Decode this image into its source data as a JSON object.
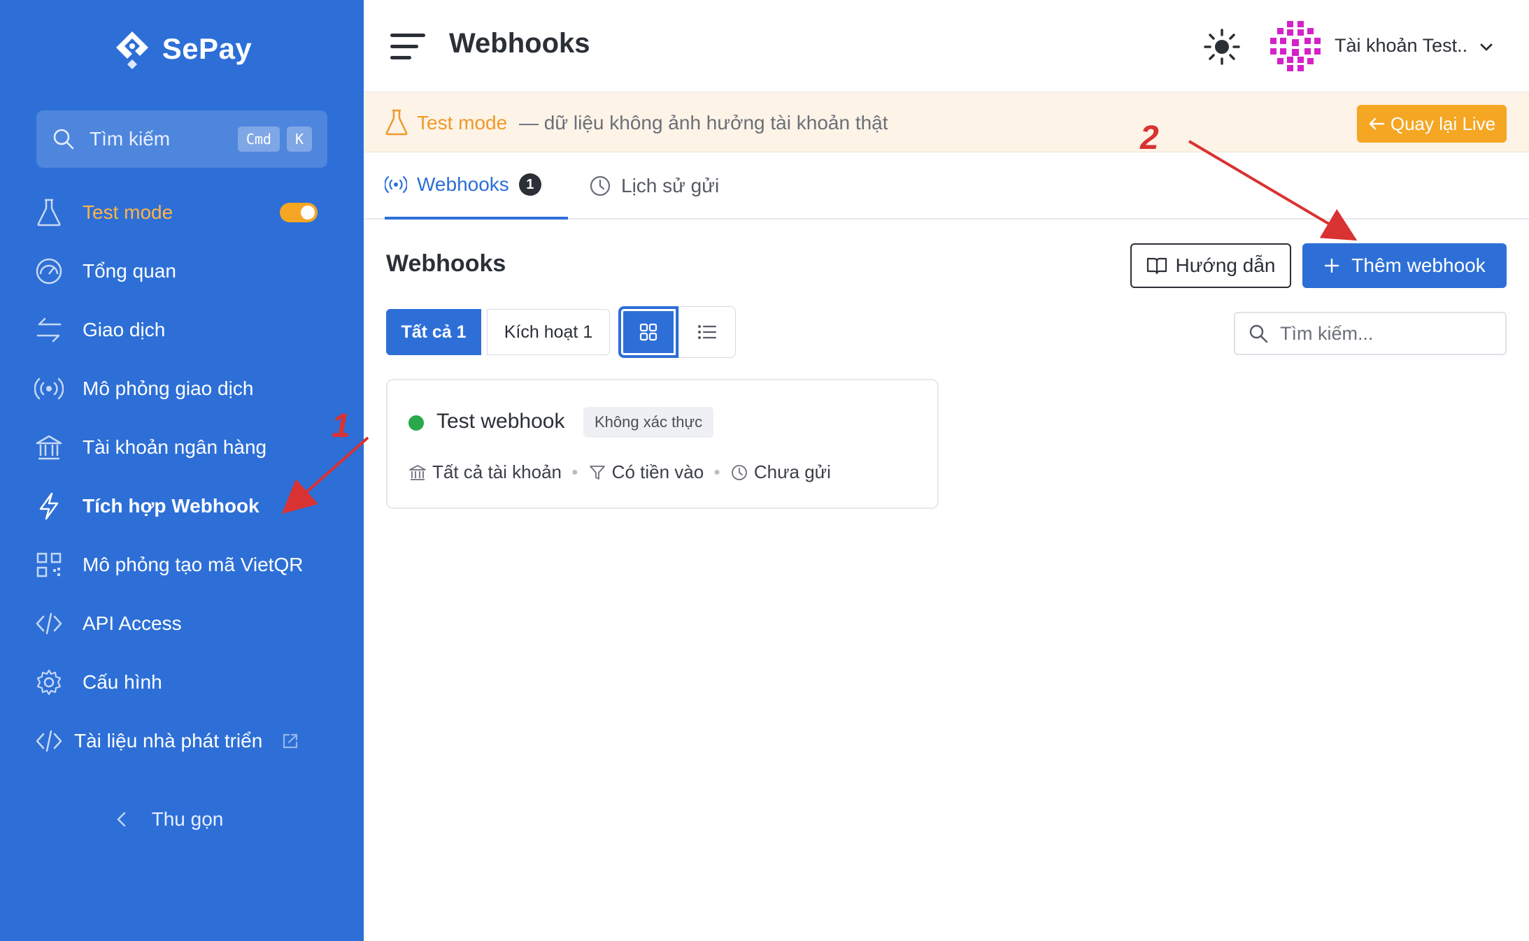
{
  "brand": {
    "name": "SePay"
  },
  "sidebar": {
    "search": {
      "placeholder": "Tìm kiếm",
      "kbd1": "Cmd",
      "kbd2": "K"
    },
    "items": [
      {
        "label": "Test mode",
        "icon": "flask-icon",
        "toggle": true
      },
      {
        "label": "Tổng quan",
        "icon": "dashboard-icon"
      },
      {
        "label": "Giao dịch",
        "icon": "transfer-icon"
      },
      {
        "label": "Mô phỏng giao dịch",
        "icon": "broadcast-icon"
      },
      {
        "label": "Tài khoản ngân hàng",
        "icon": "bank-icon"
      },
      {
        "label": "Tích hợp Webhook",
        "icon": "lightning-icon",
        "active": true
      },
      {
        "label": "Mô phỏng tạo mã VietQR",
        "icon": "qr-icon"
      },
      {
        "label": "API Access",
        "icon": "code-icon"
      },
      {
        "label": "Cấu hình",
        "icon": "gear-icon"
      },
      {
        "label": "Tài liệu nhà phát triển",
        "icon": "code-icon",
        "external": true
      }
    ],
    "collapse_label": "Thu gọn"
  },
  "header": {
    "title": "Webhooks",
    "account_name": "Tài khoản Test.."
  },
  "banner": {
    "mode_label": "Test mode",
    "description": "— dữ liệu không ảnh hưởng tài khoản thật",
    "live_button": "Quay lại Live"
  },
  "tabs": [
    {
      "label": "Webhooks",
      "count": "1",
      "active": true
    },
    {
      "label": "Lịch sử gửi"
    }
  ],
  "content": {
    "title": "Webhooks",
    "guide_button": "Hướng dẫn",
    "add_button": "Thêm webhook",
    "filters": {
      "all": "Tất cả 1",
      "active": "Kích hoạt 1"
    },
    "search_placeholder": "Tìm kiếm...",
    "webhook": {
      "name": "Test webhook",
      "auth": "Không xác thực",
      "status_color": "#2aa84a",
      "accounts": "Tất cả tài khoản",
      "event": "Có tiền vào",
      "sent": "Chưa gửi"
    }
  },
  "annotations": {
    "step1": "1",
    "step2": "2"
  },
  "colors": {
    "primary": "#2d6fd7",
    "accent": "#f5a623",
    "annotation": "#d93232"
  }
}
